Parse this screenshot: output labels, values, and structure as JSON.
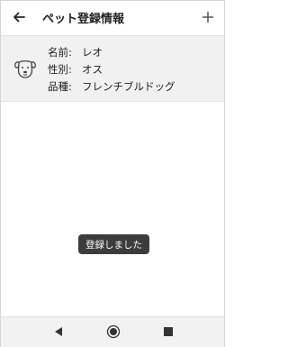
{
  "appbar": {
    "title": "ペット登録情報",
    "back_icon": "arrow-left-icon",
    "add_icon": "plus-icon"
  },
  "pet": {
    "icon": "dog-face-icon",
    "fields": [
      {
        "label": "名前:",
        "value": "レオ"
      },
      {
        "label": "性別:",
        "value": "オス"
      },
      {
        "label": "品種:",
        "value": "フレンチブルドッグ"
      }
    ]
  },
  "toast": {
    "message": "登録しました"
  },
  "navbar": {
    "back_icon": "triangle-back-icon",
    "home_icon": "circle-home-icon",
    "recent_icon": "square-recents-icon"
  }
}
